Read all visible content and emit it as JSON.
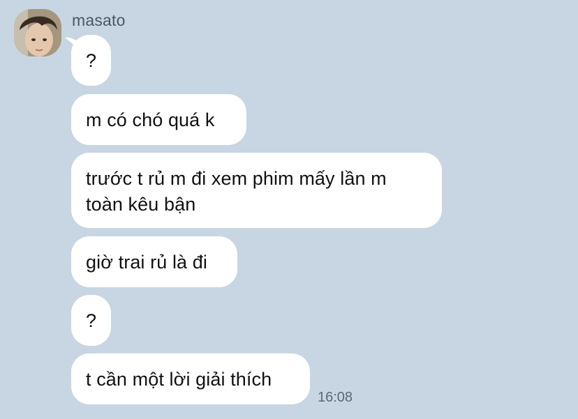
{
  "chat": {
    "sender_name": "masato",
    "messages": [
      {
        "text": "?"
      },
      {
        "text": "m có chó quá k"
      },
      {
        "text": "trước t rủ m đi xem phim mấy lần m toàn kêu bận"
      },
      {
        "text": "giờ trai rủ là đi"
      },
      {
        "text": "?"
      },
      {
        "text": "t cần một lời giải thích"
      }
    ],
    "last_timestamp": "16:08"
  },
  "colors": {
    "background": "#c8d6e3",
    "bubble": "#ffffff",
    "text": "#111111",
    "meta_text": "#5d6875"
  }
}
